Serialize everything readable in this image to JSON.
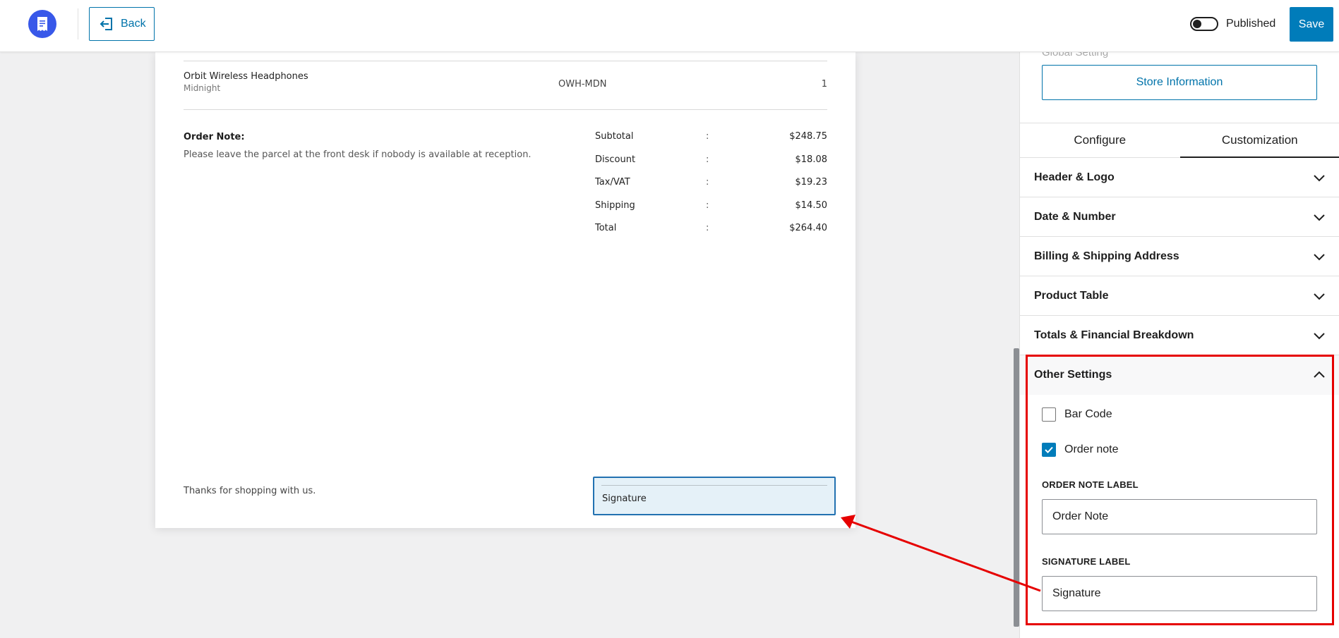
{
  "topbar": {
    "back_label": "Back",
    "published_label": "Published",
    "published_on": false,
    "save_label": "Save",
    "icons": {
      "logo": "receipt-icon",
      "back": "exit-arrow-icon"
    }
  },
  "invoice": {
    "product": {
      "name": "Orbit Wireless Headphones",
      "variant": "Midnight",
      "sku": "OWH-MDN",
      "qty": "1"
    },
    "order_note_title": "Order Note:",
    "order_note_text": "Please leave the parcel at the front desk if nobody is available at reception.",
    "totals": [
      {
        "label": "Subtotal",
        "sep": ":",
        "value": "$248.75"
      },
      {
        "label": "Discount",
        "sep": ":",
        "value": "$18.08"
      },
      {
        "label": "Tax/VAT",
        "sep": ":",
        "value": "$19.23"
      },
      {
        "label": "Shipping",
        "sep": ":",
        "value": "$14.50"
      },
      {
        "label": "Total",
        "sep": ":",
        "value": "$264.40"
      }
    ],
    "thanks": "Thanks for shopping with us.",
    "signature": "Signature"
  },
  "sidebar": {
    "global_setting_label": "Global Setting",
    "store_info_label": "Store Information",
    "tabs": [
      {
        "label": "Configure",
        "active": false
      },
      {
        "label": "Customization",
        "active": true
      }
    ],
    "sections": [
      {
        "label": "Header & Logo",
        "open": false
      },
      {
        "label": "Date & Number",
        "open": false
      },
      {
        "label": "Billing & Shipping Address",
        "open": false
      },
      {
        "label": "Product Table",
        "open": false
      },
      {
        "label": "Totals & Financial Breakdown",
        "open": false
      },
      {
        "label": "Other Settings",
        "open": true
      }
    ],
    "other_settings": {
      "bar_code": {
        "label": "Bar Code",
        "checked": false
      },
      "order_note": {
        "label": "Order note",
        "checked": true
      },
      "order_note_label_title": "ORDER NOTE LABEL",
      "order_note_label_value": "Order Note",
      "signature_label_title": "SIGNATURE LABEL",
      "signature_label_value": "Signature"
    }
  },
  "colors": {
    "accent": "#007cba",
    "logo_bg": "#3858e9",
    "annotation": "#e60000",
    "signature_highlight": "#e5f1f8"
  }
}
